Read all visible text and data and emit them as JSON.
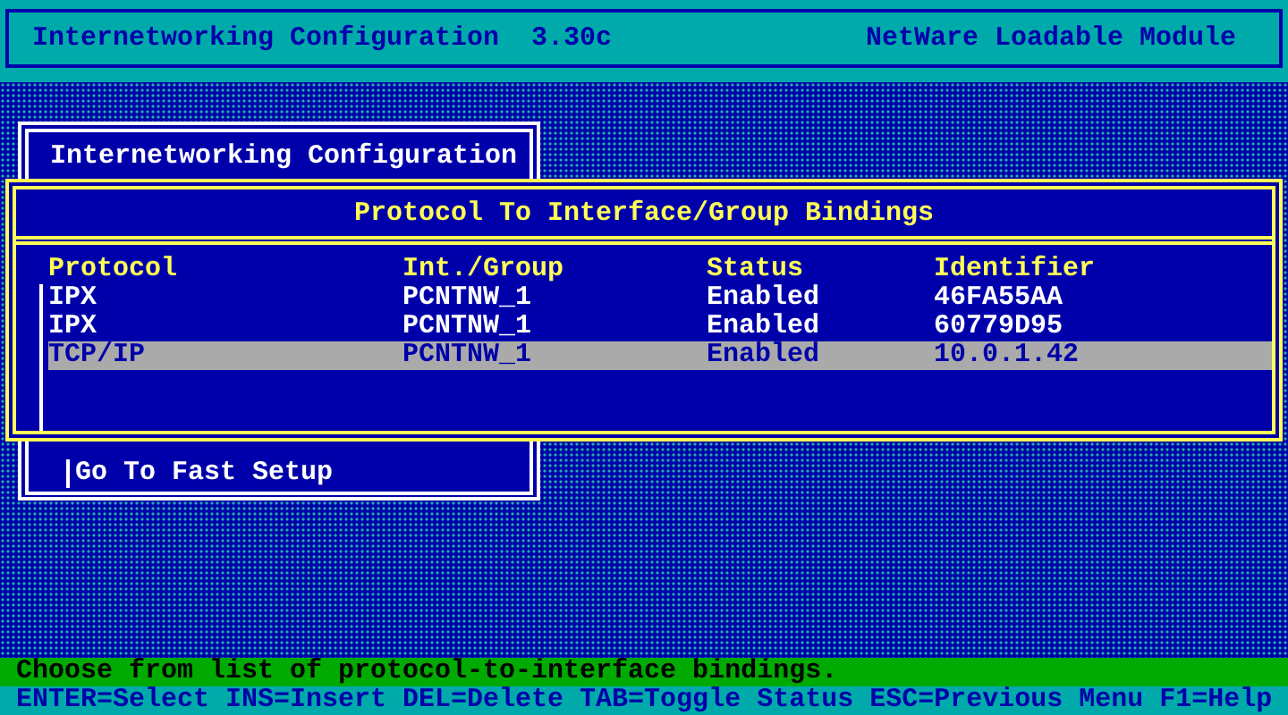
{
  "header": {
    "title": "Internetworking Configuration  3.30c",
    "module": "NetWare Loadable Module"
  },
  "menu": {
    "title": "Internetworking Configuration",
    "items": [
      "Go To Fast Setup"
    ]
  },
  "dialog": {
    "title": "Protocol To Interface/Group Bindings",
    "columns": [
      "Protocol",
      "Int./Group",
      "Status",
      "Identifier"
    ],
    "rows": [
      {
        "protocol": "IPX",
        "group": "PCNTNW_1",
        "status": "Enabled",
        "identifier": "46FA55AA",
        "selected": false
      },
      {
        "protocol": "IPX",
        "group": "PCNTNW_1",
        "status": "Enabled",
        "identifier": "60779D95",
        "selected": false
      },
      {
        "protocol": "TCP/IP",
        "group": "PCNTNW_1",
        "status": "Enabled",
        "identifier": "10.0.1.42",
        "selected": true
      }
    ]
  },
  "status_line": "Choose from list of protocol-to-interface bindings.",
  "key_help": "ENTER=Select INS=Insert DEL=Delete TAB=Toggle Status ESC=Previous Menu F1=Help"
}
